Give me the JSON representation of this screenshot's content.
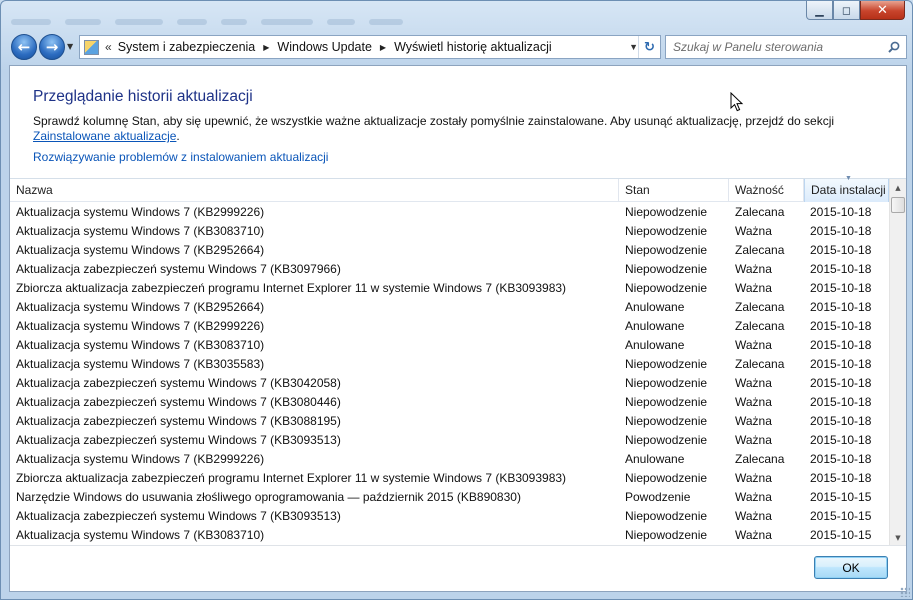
{
  "window": {
    "minimize": "▭",
    "maximize": "◻",
    "close": "✕"
  },
  "nav": {
    "back": "←",
    "forward": "→",
    "recent": "▼"
  },
  "address": {
    "prefix": "«",
    "crumbs": [
      "System i zabezpieczenia",
      "Windows Update",
      "Wyświetl historię aktualizacji"
    ],
    "dropdown": "▼",
    "refresh": "↻"
  },
  "search": {
    "placeholder": "Szukaj w Panelu sterowania"
  },
  "page": {
    "title": "Przeglądanie historii aktualizacji",
    "desc_text": "Sprawdź kolumnę Stan, aby się upewnić, że wszystkie ważne aktualizacje zostały pomyślnie zainstalowane. Aby usunąć aktualizację, przejdź do sekcji ",
    "desc_link": "Zainstalowane aktualizacje",
    "desc_end": ".",
    "troubleshoot_link": "Rozwiązywanie problemów z instalowaniem aktualizacji"
  },
  "table": {
    "headers": {
      "name": "Nazwa",
      "status": "Stan",
      "importance": "Ważność",
      "date": "Data instalacji"
    },
    "rows": [
      {
        "name": "Aktualizacja systemu Windows 7 (KB2999226)",
        "status": "Niepowodzenie",
        "importance": "Zalecana",
        "date": "2015-10-18"
      },
      {
        "name": "Aktualizacja systemu Windows 7 (KB3083710)",
        "status": "Niepowodzenie",
        "importance": "Ważna",
        "date": "2015-10-18"
      },
      {
        "name": "Aktualizacja systemu Windows 7 (KB2952664)",
        "status": "Niepowodzenie",
        "importance": "Zalecana",
        "date": "2015-10-18"
      },
      {
        "name": "Aktualizacja zabezpieczeń systemu Windows 7 (KB3097966)",
        "status": "Niepowodzenie",
        "importance": "Ważna",
        "date": "2015-10-18"
      },
      {
        "name": "Zbiorcza aktualizacja zabezpieczeń programu Internet Explorer 11 w systemie Windows 7 (KB3093983)",
        "status": "Niepowodzenie",
        "importance": "Ważna",
        "date": "2015-10-18"
      },
      {
        "name": "Aktualizacja systemu Windows 7 (KB2952664)",
        "status": "Anulowane",
        "importance": "Zalecana",
        "date": "2015-10-18"
      },
      {
        "name": "Aktualizacja systemu Windows 7 (KB2999226)",
        "status": "Anulowane",
        "importance": "Zalecana",
        "date": "2015-10-18"
      },
      {
        "name": "Aktualizacja systemu Windows 7 (KB3083710)",
        "status": "Anulowane",
        "importance": "Ważna",
        "date": "2015-10-18"
      },
      {
        "name": "Aktualizacja systemu Windows 7 (KB3035583)",
        "status": "Niepowodzenie",
        "importance": "Zalecana",
        "date": "2015-10-18"
      },
      {
        "name": "Aktualizacja zabezpieczeń systemu Windows 7 (KB3042058)",
        "status": "Niepowodzenie",
        "importance": "Ważna",
        "date": "2015-10-18"
      },
      {
        "name": "Aktualizacja zabezpieczeń systemu Windows 7 (KB3080446)",
        "status": "Niepowodzenie",
        "importance": "Ważna",
        "date": "2015-10-18"
      },
      {
        "name": "Aktualizacja zabezpieczeń systemu Windows 7 (KB3088195)",
        "status": "Niepowodzenie",
        "importance": "Ważna",
        "date": "2015-10-18"
      },
      {
        "name": "Aktualizacja zabezpieczeń systemu Windows 7 (KB3093513)",
        "status": "Niepowodzenie",
        "importance": "Ważna",
        "date": "2015-10-18"
      },
      {
        "name": "Aktualizacja systemu Windows 7 (KB2999226)",
        "status": "Anulowane",
        "importance": "Zalecana",
        "date": "2015-10-18"
      },
      {
        "name": "Zbiorcza aktualizacja zabezpieczeń programu Internet Explorer 11 w systemie Windows 7 (KB3093983)",
        "status": "Niepowodzenie",
        "importance": "Ważna",
        "date": "2015-10-18"
      },
      {
        "name": "Narzędzie Windows do usuwania złośliwego oprogramowania — październik 2015 (KB890830)",
        "status": "Powodzenie",
        "importance": "Ważna",
        "date": "2015-10-15"
      },
      {
        "name": "Aktualizacja zabezpieczeń systemu Windows 7 (KB3093513)",
        "status": "Niepowodzenie",
        "importance": "Ważna",
        "date": "2015-10-15"
      },
      {
        "name": "Aktualizacja systemu Windows 7 (KB3083710)",
        "status": "Niepowodzenie",
        "importance": "Ważna",
        "date": "2015-10-15"
      }
    ]
  },
  "scrollbar": {
    "up": "▲",
    "down": "▼"
  },
  "buttons": {
    "ok": "OK"
  }
}
